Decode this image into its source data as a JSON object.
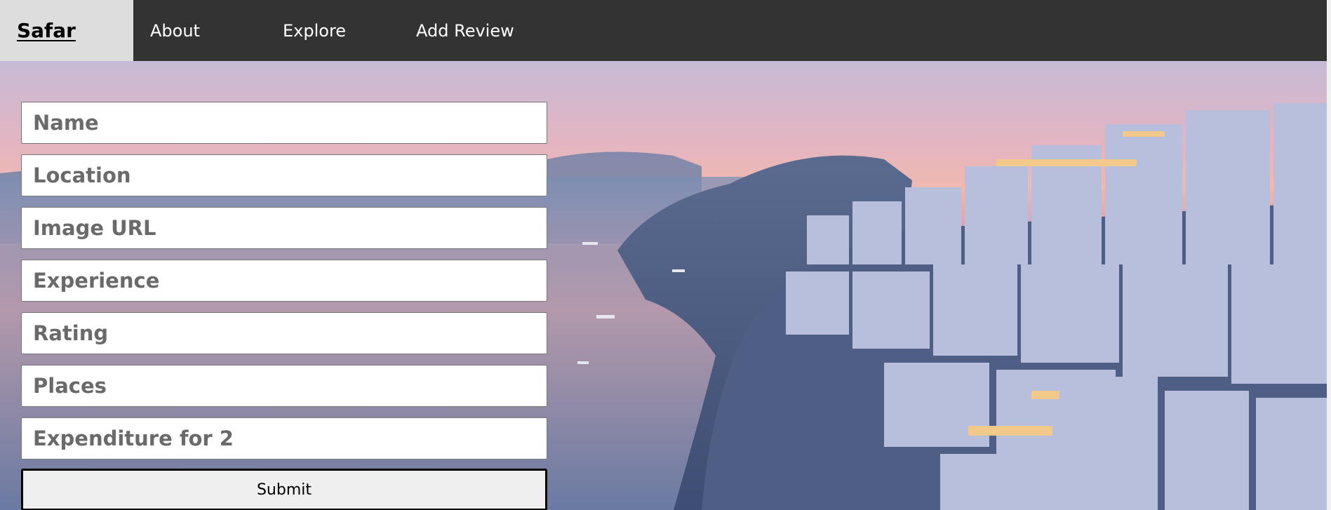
{
  "navbar": {
    "brand": "Safar",
    "items": [
      {
        "label": "About"
      },
      {
        "label": "Explore"
      },
      {
        "label": "Add Review"
      }
    ]
  },
  "form": {
    "fields": [
      {
        "placeholder": "Name"
      },
      {
        "placeholder": "Location"
      },
      {
        "placeholder": "Image URL"
      },
      {
        "placeholder": "Experience"
      },
      {
        "placeholder": "Rating"
      },
      {
        "placeholder": "Places"
      },
      {
        "placeholder": "Expenditure for 2"
      }
    ],
    "submit_label": "Submit"
  },
  "colors": {
    "navbar_bg": "#333333",
    "brand_bg": "#dddddd",
    "nav_text": "#ffffff"
  },
  "icons": {
    "background": "santorini-sunset-photo"
  }
}
